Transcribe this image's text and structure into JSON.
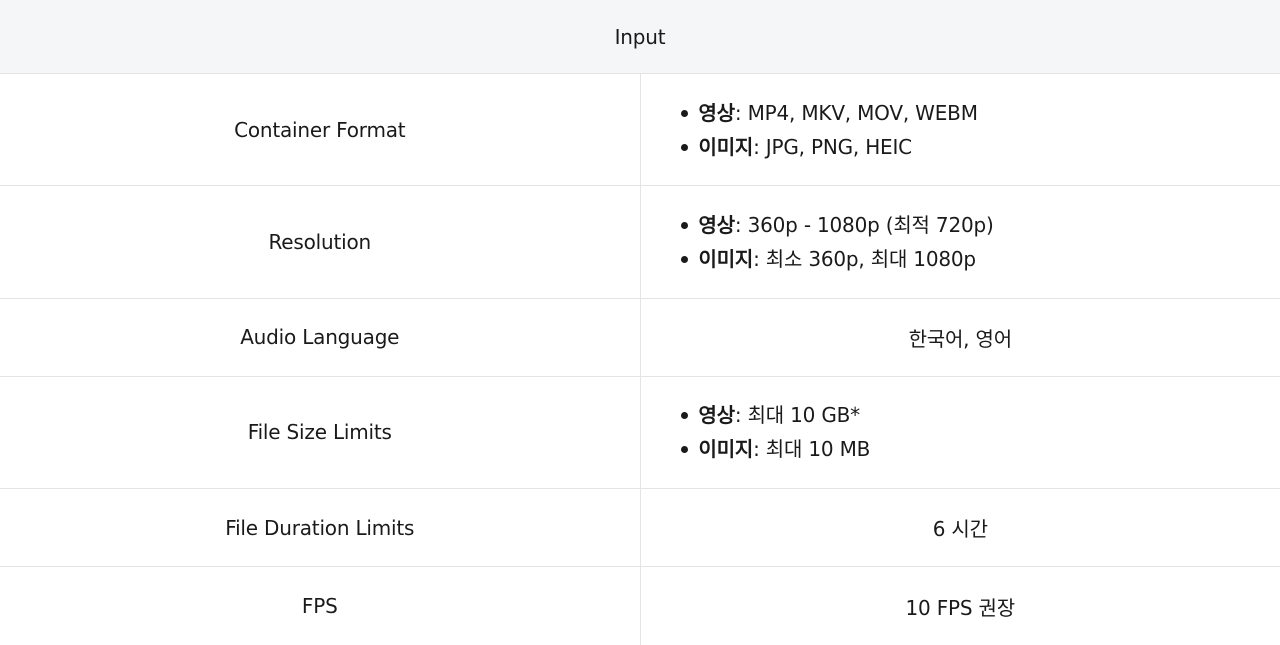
{
  "header": {
    "title": "Input"
  },
  "rows": [
    {
      "label": "Container Format",
      "items": [
        {
          "key": "영상",
          "text": ": MP4, MKV, MOV, WEBM"
        },
        {
          "key": "이미지",
          "text": ": JPG, PNG, HEIC"
        }
      ]
    },
    {
      "label": "Resolution",
      "items": [
        {
          "key": "영상",
          "text": ": 360p - 1080p (최적 720p)"
        },
        {
          "key": "이미지",
          "text": ": 최소 360p, 최대 1080p"
        }
      ]
    },
    {
      "label": "Audio Language",
      "value": "한국어, 영어"
    },
    {
      "label": "File Size Limits",
      "items": [
        {
          "key": "영상",
          "text": ": 최대 10 GB*"
        },
        {
          "key": "이미지",
          "text": ": 최대 10 MB"
        }
      ]
    },
    {
      "label": "File Duration Limits",
      "value": "6 시간"
    },
    {
      "label": "FPS",
      "value": "10 FPS 권장"
    }
  ]
}
